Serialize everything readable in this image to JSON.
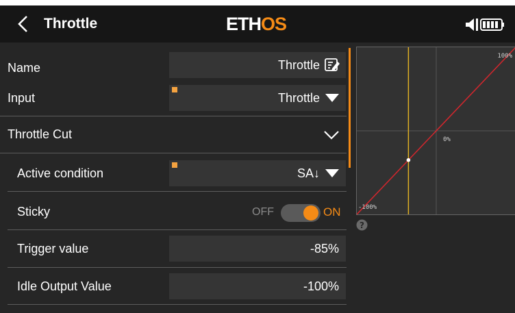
{
  "header": {
    "title": "Throttle",
    "logo_main": "ETH",
    "logo_accent": "OS",
    "icons": {
      "back": "chevron-left-icon",
      "status": "speaker-battery-icon"
    }
  },
  "form": {
    "name": {
      "label": "Name",
      "value": "Throttle",
      "icon": "edit-icon"
    },
    "input": {
      "label": "Input",
      "value": "Throttle",
      "icon": "dropdown-triangle-icon"
    },
    "throttle_cut": {
      "label": "Throttle Cut",
      "icon": "chevron-down-icon"
    },
    "active_condition": {
      "label": "Active condition",
      "value": "SA↓",
      "icon": "dropdown-triangle-icon"
    },
    "sticky": {
      "label": "Sticky",
      "off_label": "OFF",
      "on_label": "ON",
      "state": "on"
    },
    "trigger_value": {
      "label": "Trigger value",
      "value": "-85%"
    },
    "idle_output_value": {
      "label": "Idle Output Value",
      "value": "-100%"
    }
  },
  "graph": {
    "label_top_right": "100%",
    "label_center": "0%",
    "label_bottom_left": "-100%",
    "help_icon": "help-icon"
  },
  "colors": {
    "accent": "#f58b16",
    "background": "#262626",
    "field": "#353535",
    "curve": "#d6262d",
    "cursor": "#e0b022"
  },
  "chart_data": {
    "type": "line",
    "x": [
      -100,
      100
    ],
    "series": [
      {
        "values": [
          -100,
          100
        ]
      }
    ],
    "xlim": [
      -100,
      100
    ],
    "ylim": [
      -100,
      100
    ],
    "cursor_x": -35,
    "point": [
      -35,
      -35
    ],
    "grid": true
  }
}
